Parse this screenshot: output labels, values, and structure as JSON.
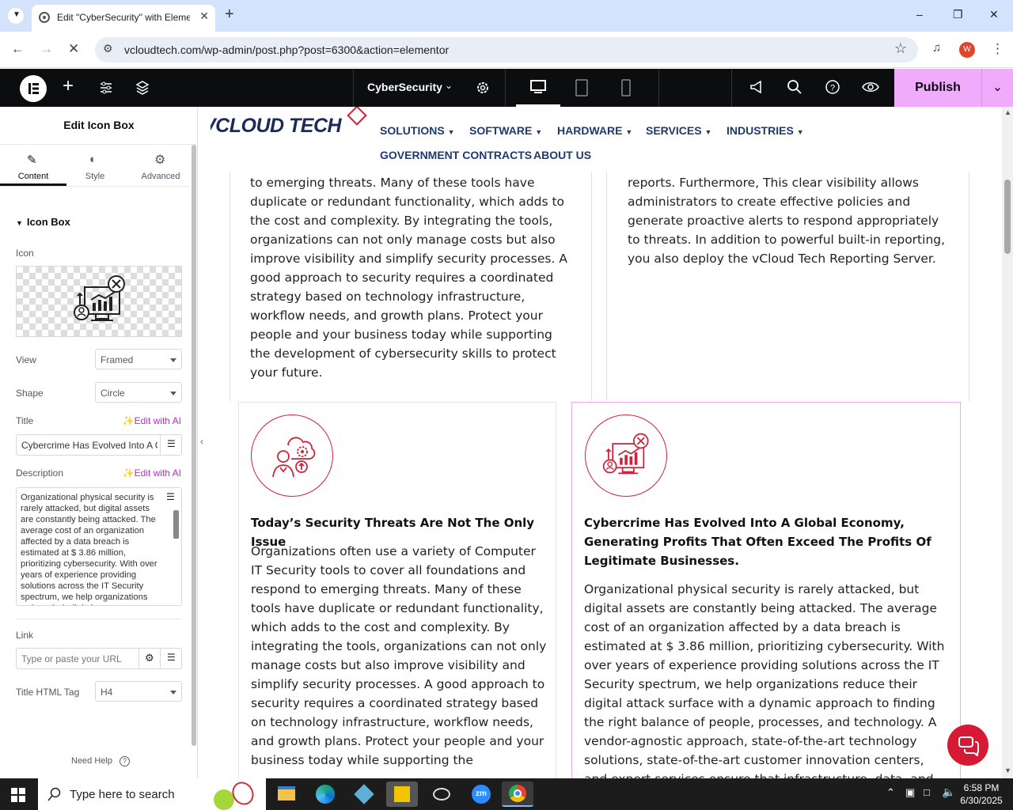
{
  "browser": {
    "tab_title": "Edit \"CyberSecurity\" with Eleme",
    "url": "vcloudtech.com/wp-admin/post.php?post=6300&action=elementor"
  },
  "editor": {
    "page_name": "CyberSecurity",
    "publish_label": "Publish"
  },
  "sidebar": {
    "panel_title": "Edit Icon Box",
    "tabs": [
      {
        "label": "Content"
      },
      {
        "label": "Style"
      },
      {
        "label": "Advanced"
      }
    ],
    "section_title": "Icon Box",
    "icon_label": "Icon",
    "view_label": "View",
    "view_value": "Framed",
    "shape_label": "Shape",
    "shape_value": "Circle",
    "title_label": "Title",
    "edit_ai": "Edit with AI",
    "title_value": "Cybercrime Has Evolved Into A G",
    "description_label": "Description",
    "description_value": "Organizational physical security is rarely attacked, but digital assets are constantly being attacked. The average cost of an organization affected by a data breach is estimated at $ 3.86 million, prioritizing cybersecurity. With over years of experience providing solutions across the IT Security spectrum, we help organizations reduce their digital",
    "link_label": "Link",
    "link_placeholder": "Type or paste your URL",
    "html_tag_label": "Title HTML Tag",
    "html_tag_value": "H4",
    "need_help": "Need Help"
  },
  "site": {
    "logo_text": "VCLOUD TECH",
    "menu": [
      {
        "label": "SOLUTIONS"
      },
      {
        "label": "SOFTWARE"
      },
      {
        "label": "HARDWARE"
      },
      {
        "label": "SERVICES"
      },
      {
        "label": "INDUSTRIES"
      },
      {
        "label": "GOVERNMENT CONTRACTS"
      },
      {
        "label": "ABOUT US"
      }
    ]
  },
  "content": {
    "upper_left_text": "to emerging threats. Many of these tools have duplicate or redundant functionality, which adds to the cost and complexity. By integrating the tools, organizations can not only manage costs but also improve visibility and simplify security processes. A good approach to security requires a coordinated strategy based on technology infrastructure, workflow needs, and growth plans. Protect your people and your business today while supporting the development of cybersecurity skills to protect your future.",
    "upper_right_text": "reports. Furthermore, This clear visibility allows administrators to create effective policies and generate proactive alerts to respond appropriately to threats. In addition to powerful built-in reporting, you also deploy the vCloud Tech Reporting Server.",
    "card1_title": "Today’s Security Threats Are Not The Only Issue",
    "card1_text": "Organizations often use a variety of Computer IT Security tools to cover all foundations and respond to emerging threats. Many of these tools have duplicate or redundant functionality, which adds to the cost and complexity. By integrating the tools, organizations can not only manage costs but also improve visibility and simplify security processes. A good approach to security requires a coordinated strategy based on technology infrastructure, workflow needs, and growth plans. Protect your people and your business today while supporting the",
    "card2_title": "Cybercrime Has Evolved Into A Global Economy, Generating Profits That Often Exceed The Profits Of Legitimate Businesses.",
    "card2_text": "Organizational physical security is rarely attacked, but digital assets are constantly being attacked. The average cost of an organization affected by a data breach is estimated at $ 3.86 million, prioritizing cybersecurity. With over years of experience providing solutions across the IT Security spectrum, we help organizations reduce their digital attack surface with a dynamic approach to finding the right balance of people, processes, and technology. A vendor-agnostic approach, state-of-the-art technology solutions, state-of-the-art customer innovation centers, and expert services ensure that infrastructure, data, and"
  },
  "taskbar": {
    "search_placeholder": "Type here to search",
    "time": "6:58 PM",
    "date": "6/30/2025"
  },
  "colors": {
    "accent_pink": "#f0abfc",
    "elementor_dark": "#0c0d0e",
    "brand_red": "#d0233b",
    "ai_purple": "#c026d3"
  }
}
